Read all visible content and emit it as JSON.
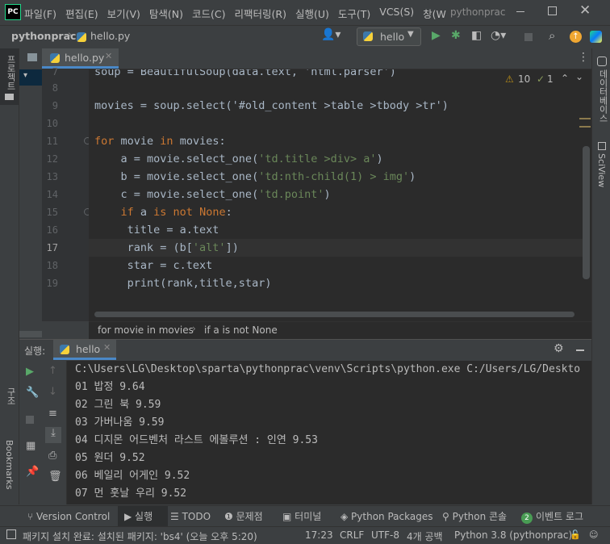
{
  "window": {
    "app_icon": "PC",
    "menu": [
      "파일(F)",
      "편집(E)",
      "보기(V)",
      "탐색(N)",
      "코드(C)",
      "리팩터링(R)",
      "실행(U)",
      "도구(T)",
      "VCS(S)",
      "창(W"
    ],
    "title": "pythonprac"
  },
  "navbar": {
    "project": "pythonprac",
    "file": "hello.py",
    "run_config": "hello"
  },
  "side": {
    "left_project": "프로젝트",
    "left_structure": "구조",
    "left_bookmarks": "Bookmarks",
    "right_db": "데이터베이스",
    "right_sciview": "SciView"
  },
  "editor": {
    "tab": "hello.py",
    "warnings": "10",
    "weak_warnings": "1",
    "line_numbers": [
      "7",
      "8",
      "9",
      "10",
      "11",
      "12",
      "13",
      "14",
      "15",
      "16",
      "17",
      "18",
      "19"
    ],
    "line7": "soup = BeautifulSoup(data.text, 'html.parser')",
    "line9": "movies = soup.select('#old_content >table >tbody >tr')",
    "l11_kw1": "for",
    "l11_mid": " movie ",
    "l11_kw2": "in",
    "l11_end": " movies:",
    "l12_a": "    a = movie.select_one(",
    "l12_s": "'td.title >div> a'",
    "l12_e": ")",
    "l13_a": "    b = movie.select_one(",
    "l13_s": "'td:nth-child(1) > img'",
    "l13_e": ")",
    "l14_a": "    c = movie.select_one(",
    "l14_s": "'td.point'",
    "l14_e": ")",
    "l15_kw1": "    if",
    "l15_mid": " a ",
    "l15_kw2": "is not None",
    "l15_e": ":",
    "l16": "     title = a.text",
    "l17_a": "     rank = (b[",
    "l17_s": "'alt'",
    "l17_e": "])",
    "l18": "     star = c.text",
    "l19": "     print(rank,title,star)",
    "breadcrumb": [
      "for movie in movies",
      "if a is not None"
    ]
  },
  "run": {
    "label": "실행:",
    "tab": "hello",
    "output": [
      "C:\\Users\\LG\\Desktop\\sparta\\pythonprac\\venv\\Scripts\\python.exe C:/Users/LG/Deskto",
      "01 밥정 9.64",
      "02 그린 북 9.59",
      "03 가버나움 9.59",
      "04 디지몬 어드벤처 라스트 에볼루션 : 인연 9.53",
      "05 원더 9.52",
      "06 베일리 어게인 9.52",
      "07 먼 훗날 우리 9.52"
    ]
  },
  "bottom_tabs": [
    "Version Control",
    "실행",
    "TODO",
    "문제점",
    "터미널",
    "Python Packages",
    "Python 콘솔",
    "이벤트 로그"
  ],
  "event_count": "2",
  "status": {
    "message": "패키지 설치 완료: 설치된 패키지: 'bs4' (오늘 오후 5:20)",
    "position": "17:23",
    "line_sep": "CRLF",
    "encoding": "UTF-8",
    "indent": "4개 공백",
    "interpreter": "Python 3.8 (pythonprac)"
  }
}
